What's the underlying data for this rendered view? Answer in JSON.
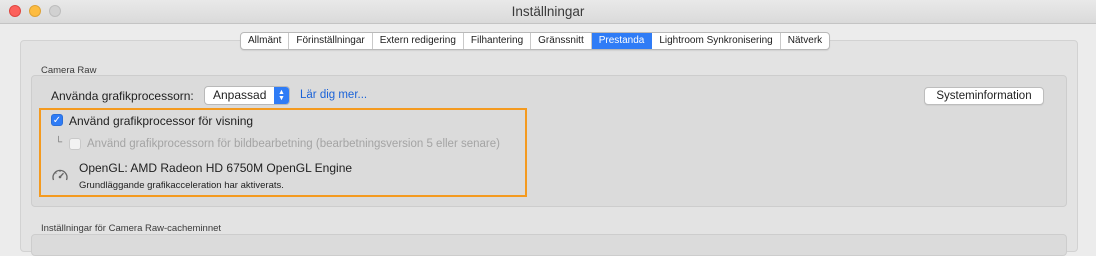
{
  "window": {
    "title": "Inställningar"
  },
  "tabs": [
    {
      "label": "Allmänt",
      "active": false
    },
    {
      "label": "Förinställningar",
      "active": false
    },
    {
      "label": "Extern redigering",
      "active": false
    },
    {
      "label": "Filhantering",
      "active": false
    },
    {
      "label": "Gränssnitt",
      "active": false
    },
    {
      "label": "Prestanda",
      "active": true
    },
    {
      "label": "Lightroom Synkronisering",
      "active": false
    },
    {
      "label": "Nätverk",
      "active": false
    }
  ],
  "camera_raw": {
    "section_title": "Camera Raw",
    "gpu_label": "Använda grafikprocessorn:",
    "gpu_mode_selected": "Anpassad",
    "learn_more_link": "Lär dig mer...",
    "system_info_button": "Systeminformation",
    "use_gpu_for_display": {
      "label": "Använd grafikprocessor för visning",
      "checked": true
    },
    "use_gpu_for_image_processing": {
      "label": "Använd grafikprocessorn för bildbearbetning (bearbetningsversion 5 eller senare)",
      "checked": false,
      "enabled": false
    },
    "opengl_info": "OpenGL: AMD Radeon HD 6750M OpenGL Engine",
    "acceleration_status": "Grundläggande grafikacceleration har aktiverats."
  },
  "cache": {
    "section_title": "Inställningar för Camera Raw-cacheminnet"
  },
  "colors": {
    "accent": "#2f7cf6",
    "highlight_border": "#f49a1f",
    "link": "#1b63d8"
  },
  "icons": {
    "gauge": "speedometer-icon",
    "checkmark": "checkmark-icon"
  }
}
